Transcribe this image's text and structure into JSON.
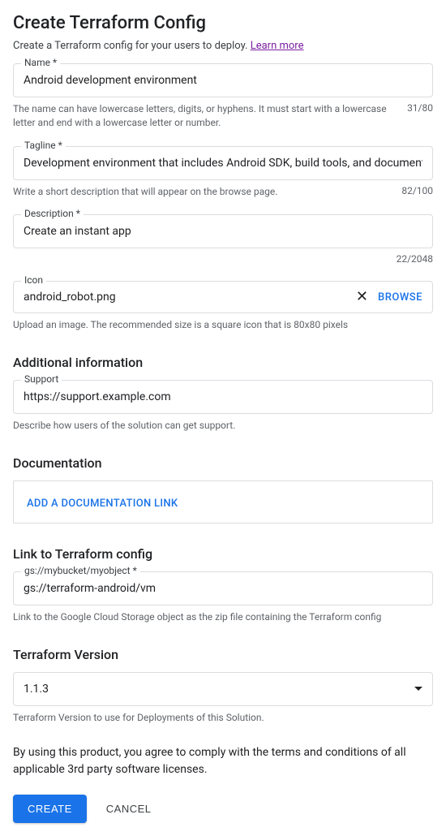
{
  "header": {
    "title": "Create Terraform Config",
    "subtitle": "Create a Terraform config for your users to deploy. ",
    "learn_more": "Learn more"
  },
  "fields": {
    "name": {
      "label": "Name *",
      "value": "Android development environment",
      "helper": "The name can have lowercase letters, digits, or hyphens. It must start with a lowercase letter and end with a lowercase letter or number.",
      "count": "31/80"
    },
    "tagline": {
      "label": "Tagline *",
      "value": "Development environment that includes Android SDK, build tools, and documentation.",
      "helper": "Write a short description that will appear on the browse page.",
      "count": "82/100"
    },
    "description": {
      "label": "Description *",
      "value": "Create an instant app",
      "count": "22/2048"
    },
    "icon": {
      "label": "Icon",
      "value": "android_robot.png",
      "browse": "BROWSE",
      "helper": "Upload an image. The recommended size is a square icon that is 80x80 pixels"
    }
  },
  "additional": {
    "title": "Additional information",
    "support": {
      "label": "Support",
      "value": "https://support.example.com",
      "helper": "Describe how users of the solution can get support."
    }
  },
  "documentation": {
    "title": "Documentation",
    "add_link": "ADD A DOCUMENTATION LINK"
  },
  "link_config": {
    "title": "Link to Terraform config",
    "field": {
      "label": "gs://mybucket/myobject *",
      "value": "gs://terraform-android/vm",
      "helper": "Link to the Google Cloud Storage object as the zip file containing the Terraform config"
    }
  },
  "version": {
    "title": "Terraform Version",
    "value": "1.1.3",
    "helper": "Terraform Version to use for Deployments of this Solution."
  },
  "agree": "By using this product, you agree to comply with the terms and conditions of all applicable 3rd party software licenses.",
  "buttons": {
    "create": "CREATE",
    "cancel": "CANCEL"
  }
}
